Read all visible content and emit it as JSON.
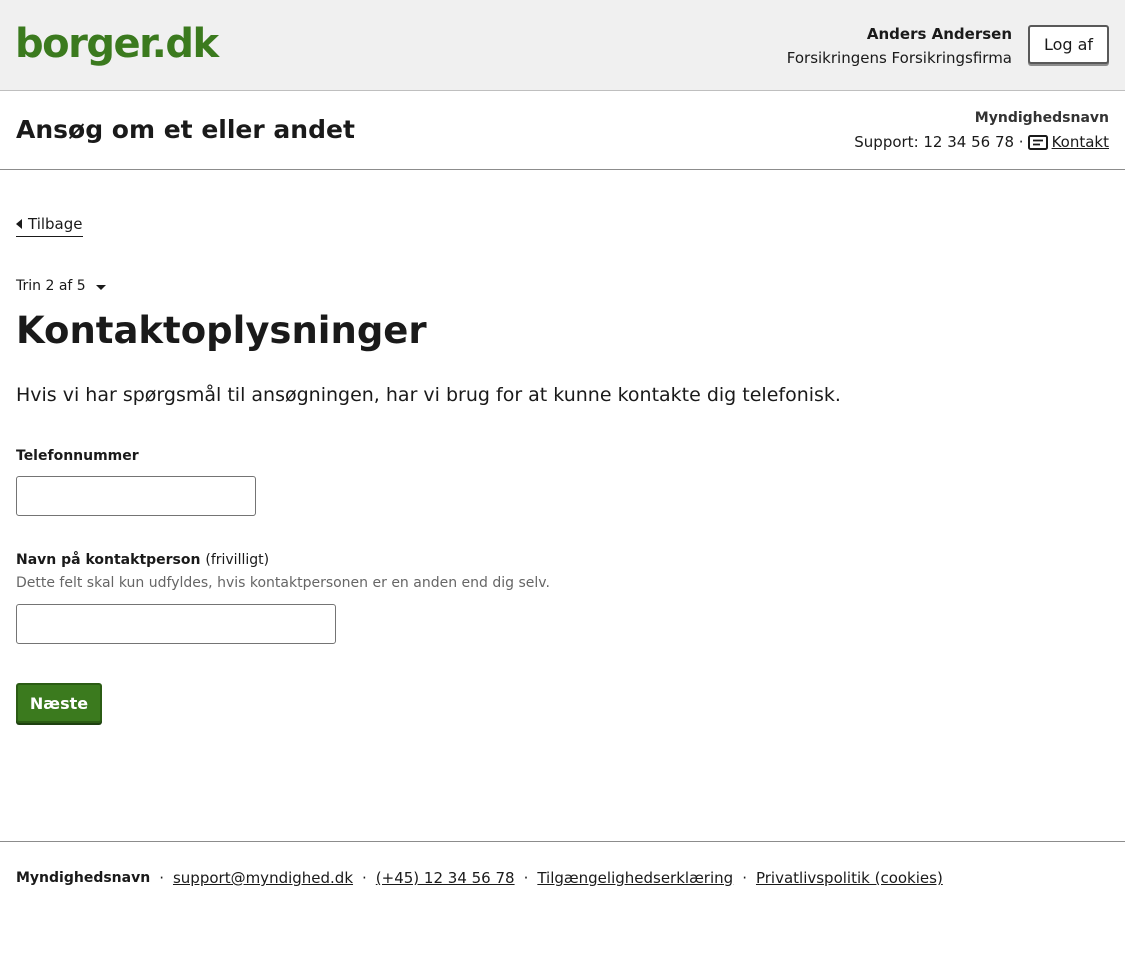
{
  "header": {
    "logo": "borger.dk",
    "user_name": "Anders Andersen",
    "user_org": "Forsikringens Forsikringsfirma",
    "logout_label": "Log af"
  },
  "service": {
    "title": "Ansøg om et eller andet",
    "authority": "Myndighedsnavn",
    "support_text": "Support: 12 34 56 78 ·",
    "contact_label": "Kontakt",
    "contact_icon": "contact-card-icon"
  },
  "main": {
    "back_label": "Tilbage",
    "step_label": "Trin 2 af 5",
    "heading": "Kontaktoplysninger",
    "intro": "Hvis vi har spørgsmål til ansøgningen, har vi brug for at kunne kontakte dig telefonisk.",
    "phone": {
      "label": "Telefonnummer",
      "value": "",
      "placeholder": ""
    },
    "contact_person": {
      "label": "Navn på kontaktperson",
      "optional": "(frivilligt)",
      "hint": "Dette felt skal kun udfyldes, hvis kontaktpersonen er en anden end dig selv.",
      "value": "",
      "placeholder": ""
    },
    "next_label": "Næste"
  },
  "footer": {
    "name": "Myndighedsnavn",
    "separator": "·",
    "email": "support@myndighed.dk",
    "phone": "(+45) 12 34 56 78",
    "accessibility": "Tilgængelighedserklæring",
    "privacy": "Privatlivspolitik (cookies)"
  },
  "colors": {
    "brand_green": "#3b7a1e",
    "header_bg": "#f0f0f0",
    "text": "#1a1a1a"
  }
}
